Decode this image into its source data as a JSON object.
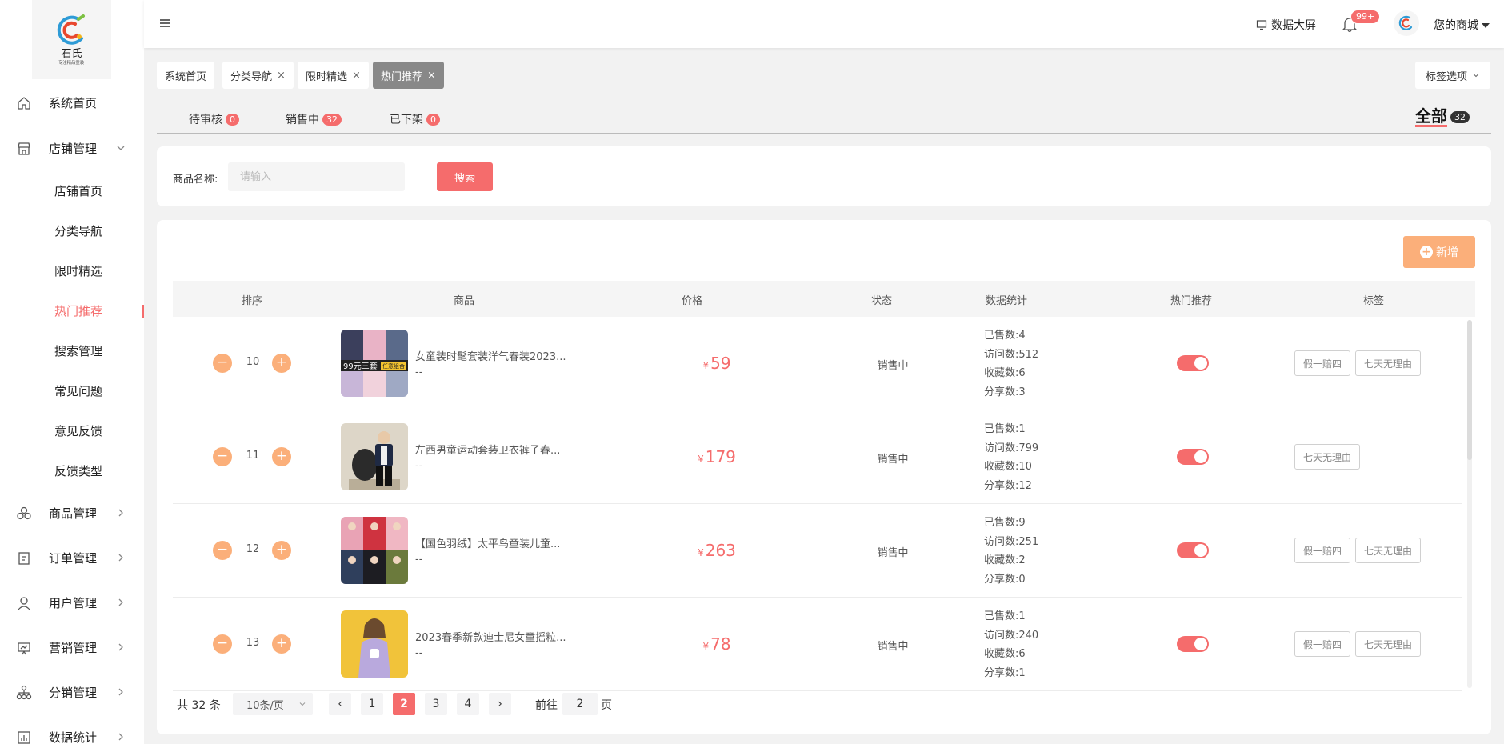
{
  "brand": {
    "name": "石氏",
    "slogan": "专注精品童装"
  },
  "sidebar": {
    "items": [
      {
        "label": "系统首页",
        "icon": "home-icon"
      },
      {
        "label": "店铺管理",
        "icon": "store-icon",
        "expanded": true
      },
      {
        "label": "商品管理",
        "icon": "product-icon"
      },
      {
        "label": "订单管理",
        "icon": "order-icon"
      },
      {
        "label": "用户管理",
        "icon": "user-icon"
      },
      {
        "label": "营销管理",
        "icon": "marketing-icon"
      },
      {
        "label": "分销管理",
        "icon": "distribution-icon"
      },
      {
        "label": "数据统计",
        "icon": "statistics-icon"
      }
    ],
    "subitems": [
      "店铺首页",
      "分类导航",
      "限时精选",
      "热门推荐",
      "搜索管理",
      "常见问题",
      "意见反馈",
      "反馈类型"
    ],
    "active_subitem": "热门推荐",
    "accent_color": "#f56c6c"
  },
  "header": {
    "data_screen": "数据大屏",
    "notification_badge": "99+",
    "shop_name": "您的商城"
  },
  "tags": {
    "items": [
      {
        "label": "系统首页",
        "closable": false
      },
      {
        "label": "分类导航",
        "closable": true
      },
      {
        "label": "限时精选",
        "closable": true
      },
      {
        "label": "热门推荐",
        "closable": true,
        "active": true
      }
    ],
    "close_glyph": "×",
    "options_label": "标签选项"
  },
  "status_tabs": [
    {
      "label": "待审核",
      "count": "0"
    },
    {
      "label": "销售中",
      "count": "32"
    },
    {
      "label": "已下架",
      "count": "0"
    }
  ],
  "all_tab": {
    "label": "全部",
    "count": "32"
  },
  "search": {
    "label": "商品名称:",
    "placeholder": "请输入",
    "value": "",
    "button": "搜索"
  },
  "add_button": "新增",
  "table": {
    "columns": [
      "排序",
      "商品",
      "价格",
      "状态",
      "数据统计",
      "热门推荐",
      "标签"
    ],
    "currency": "¥",
    "rows": [
      {
        "rank": "10",
        "name": "女童装时髦套装洋气春装2023...",
        "sub": "--",
        "price": "59",
        "status": "销售中",
        "stats": [
          "已售数:4",
          "访问数:512",
          "收藏数:6",
          "分享数:3"
        ],
        "hot": true,
        "tags": [
          "假一赔四",
          "七天无理由"
        ]
      },
      {
        "rank": "11",
        "name": "左西男童运动套装卫衣裤子春...",
        "sub": "--",
        "price": "179",
        "status": "销售中",
        "stats": [
          "已售数:1",
          "访问数:799",
          "收藏数:10",
          "分享数:12"
        ],
        "hot": true,
        "tags": [
          "七天无理由"
        ]
      },
      {
        "rank": "12",
        "name": "【国色羽绒】太平鸟童装儿童...",
        "sub": "--",
        "price": "263",
        "status": "销售中",
        "stats": [
          "已售数:9",
          "访问数:251",
          "收藏数:2",
          "分享数:0"
        ],
        "hot": true,
        "tags": [
          "假一赔四",
          "七天无理由"
        ]
      },
      {
        "rank": "13",
        "name": "2023春季新款迪士尼女童摇粒...",
        "sub": "--",
        "price": "78",
        "status": "销售中",
        "stats": [
          "已售数:1",
          "访问数:240",
          "收藏数:6",
          "分享数:1"
        ],
        "hot": true,
        "tags": [
          "假一赔四",
          "七天无理由"
        ]
      }
    ],
    "image_captions": [
      "99元三套",
      "任意组合"
    ]
  },
  "pagination": {
    "total": "共 32 条",
    "page_size": "10条/页",
    "pages": [
      "1",
      "2",
      "3",
      "4"
    ],
    "current": "2",
    "jump_prefix": "前往",
    "jump_value": "2",
    "jump_suffix": "页"
  }
}
